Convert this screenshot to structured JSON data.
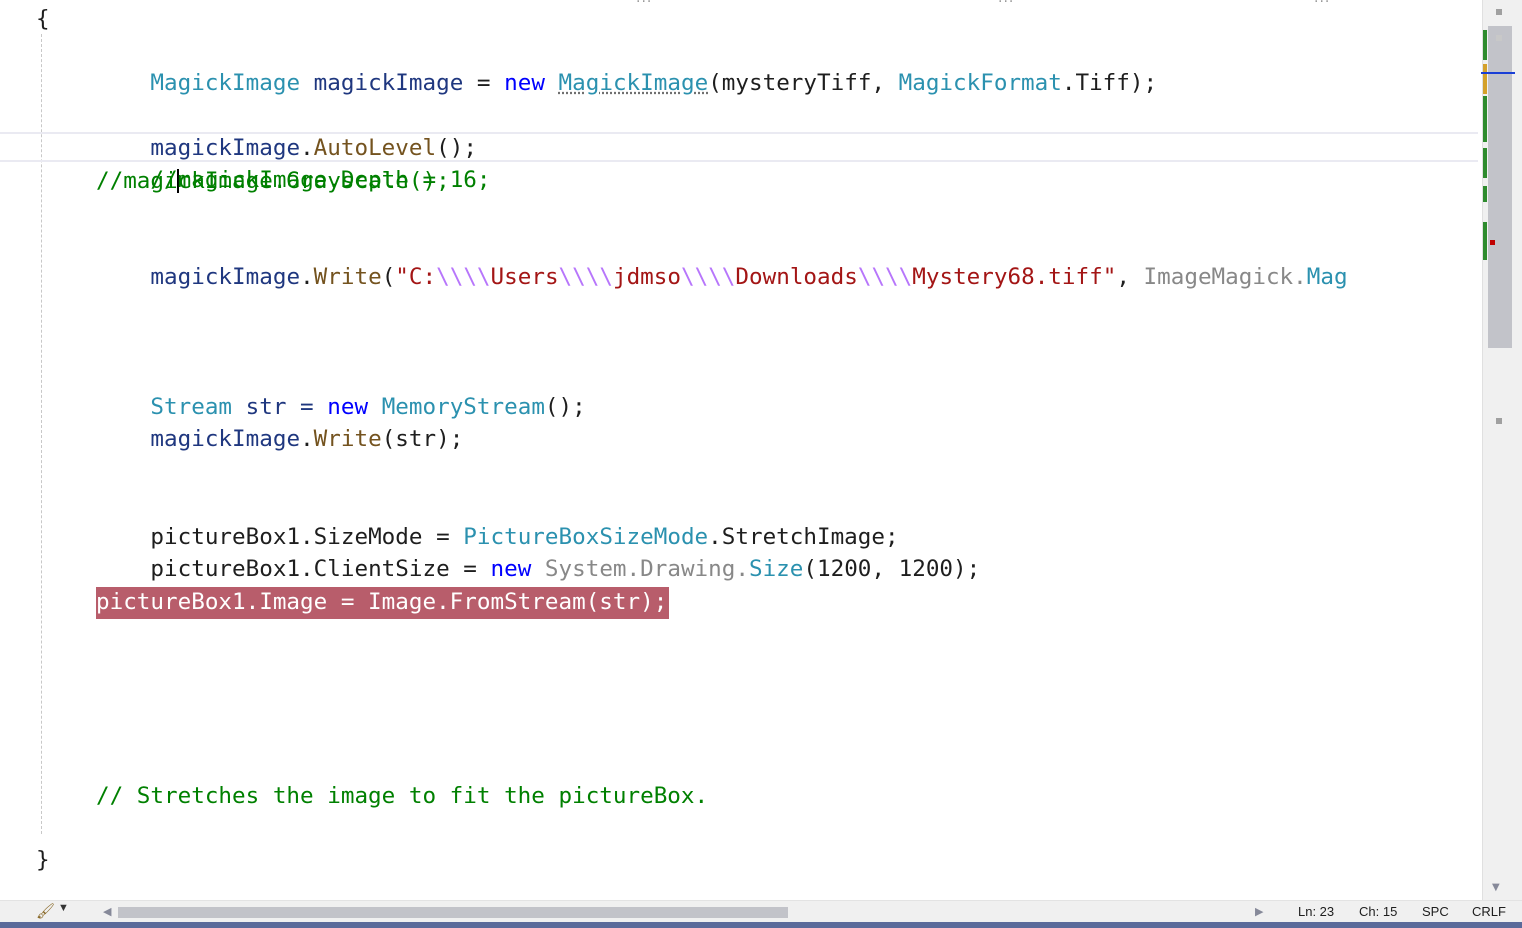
{
  "editor": {
    "open_brace": "{",
    "close_brace": "}",
    "line1": {
      "type1": "MagickImage",
      "var": " magickImage ",
      "eq": "= ",
      "kw": "new",
      "sp": " ",
      "type2": "MagickImage",
      "p1": "(mysteryTiff, ",
      "type3": "MagickFormat",
      "p2": ".Tiff);"
    },
    "line2": {
      "obj": "magickImage",
      "dot": ".",
      "method": "AutoLevel",
      "rest": "();"
    },
    "line3": {
      "pre": "//",
      "post": "magickImage.Depth = 16;"
    },
    "line4": "//magickImage.Grayscale();",
    "line5": {
      "obj": "magickImage",
      "dot": ".",
      "method": "Write",
      "p": "(",
      "s1": "\"C:",
      "e1": "\\\\\\\\",
      "s2": "Users",
      "e2": "\\\\\\\\",
      "s3": "jdmso",
      "e3": "\\\\\\\\",
      "s4": "Downloads",
      "e4": "\\\\\\\\",
      "s5": "Mystery68.tiff\"",
      "comma": ", ",
      "ns": "ImageMagick.",
      "tail": "Mag"
    },
    "line6": {
      "type1": "Stream",
      "mid": " str = ",
      "kw": "new",
      "sp": " ",
      "type2": "MemoryStream",
      "rest": "();"
    },
    "line7": {
      "obj": "magickImage",
      "dot": ".",
      "method": "Write",
      "rest": "(str);"
    },
    "line8": {
      "pre": "pictureBox1.SizeMode = ",
      "type": "PictureBoxSizeMode",
      "rest": ".StretchImage;"
    },
    "line9": {
      "pre": "pictureBox1.ClientSize = ",
      "kw": "new",
      "sp": " ",
      "ns": "System.Drawing.",
      "type": "Size",
      "rest": "(1200, 1200);"
    },
    "line10": "pictureBox1.Image = Image.FromStream(str);",
    "line11": "// Stretches the image to fit the pictureBox."
  },
  "statusbar": {
    "line": "Ln: 23",
    "col": "Ch: 15",
    "indent": "SPC",
    "eol": "CRLF"
  },
  "icons": [
    "brush-icon",
    "dropdown-icon",
    "scroll-left-icon",
    "scroll-right-icon",
    "scroll-up-icon",
    "scroll-down-icon"
  ],
  "colors": {
    "highlight": "#b85d6b",
    "type": "#2b91af",
    "keyword": "#0000ff",
    "method": "#74531f",
    "string": "#a31515",
    "comment": "#008000"
  }
}
